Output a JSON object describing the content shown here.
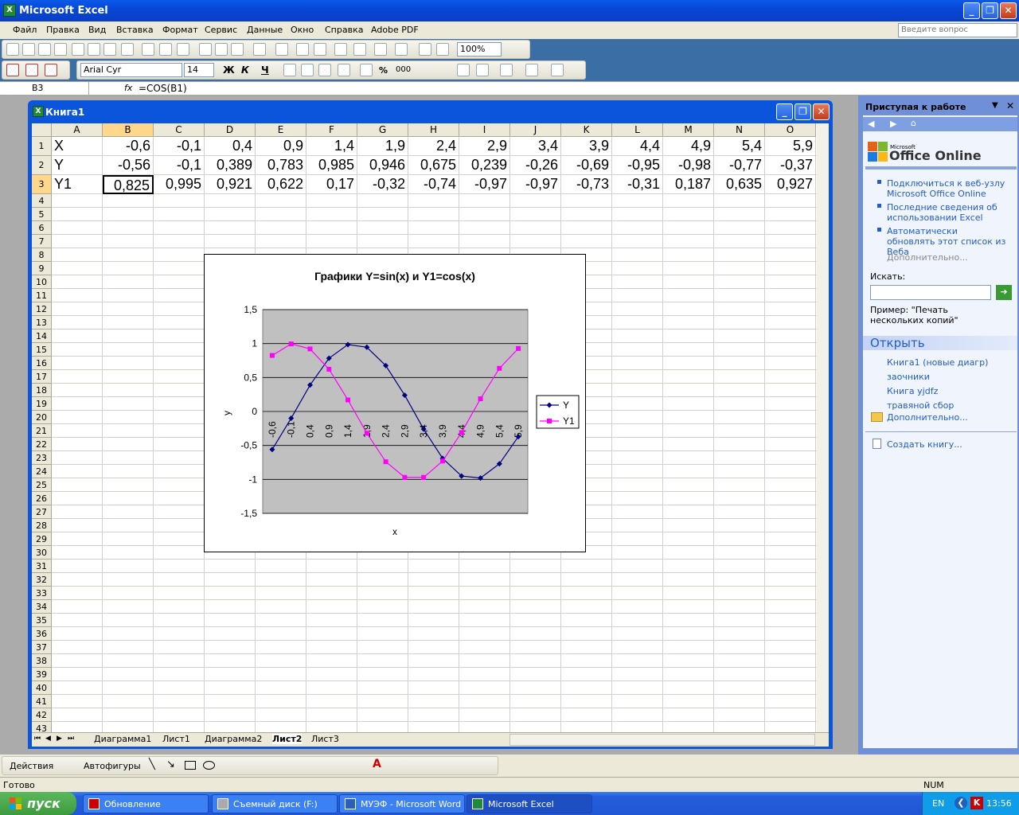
{
  "app": {
    "title": "Microsoft Excel",
    "icon": "excel-icon"
  },
  "menu": [
    "Файл",
    "Правка",
    "Вид",
    "Вставка",
    "Формат",
    "Сервис",
    "Данные",
    "Окно",
    "Справка",
    "Adobe PDF"
  ],
  "help_placeholder": "Введите вопрос",
  "toolbar": {
    "zoom": "100%",
    "font": "Arial Cyr",
    "size": "14",
    "bold": "Ж",
    "italic": "К",
    "underline": "Ч",
    "percent": "%",
    "thousands": "000"
  },
  "formula": {
    "namebox": "B3",
    "fx": "fx",
    "value": "=COS(B1)"
  },
  "workbook": {
    "title": "Книга1"
  },
  "columns": [
    "A",
    "B",
    "C",
    "D",
    "E",
    "F",
    "G",
    "H",
    "I",
    "J",
    "K",
    "L",
    "M",
    "N",
    "O"
  ],
  "rows_count": 43,
  "cells": [
    [
      "X",
      "-0,6",
      "-0,1",
      "0,4",
      "0,9",
      "1,4",
      "1,9",
      "2,4",
      "2,9",
      "3,4",
      "3,9",
      "4,4",
      "4,9",
      "5,4",
      "5,9"
    ],
    [
      "Y",
      "-0,56",
      "-0,1",
      "0,389",
      "0,783",
      "0,985",
      "0,946",
      "0,675",
      "0,239",
      "-0,26",
      "-0,69",
      "-0,95",
      "-0,98",
      "-0,77",
      "-0,37"
    ],
    [
      "Y1",
      "0,825",
      "0,995",
      "0,921",
      "0,622",
      "0,17",
      "-0,32",
      "-0,74",
      "-0,97",
      "-0,97",
      "-0,73",
      "-0,31",
      "0,187",
      "0,635",
      "0,927"
    ]
  ],
  "sheets": [
    "Диаграмма1",
    "Лист1",
    "Диаграмма2",
    "Лист2",
    "Лист3"
  ],
  "active_sheet": "Лист2",
  "chart_data": {
    "type": "line",
    "title": "Графики Y=sin(x) и Y1=cos(x)",
    "xlabel": "x",
    "ylabel": "y",
    "categories": [
      "-0,6",
      "-0,1",
      "0,4",
      "0,9",
      "1,4",
      "1,9",
      "2,4",
      "2,9",
      "3,4",
      "3,9",
      "4,4",
      "4,9",
      "5,4",
      "5,9"
    ],
    "ylim": [
      -1.5,
      1.5
    ],
    "yticks": [
      "1,5",
      "1",
      "0,5",
      "0",
      "-0,5",
      "-1",
      "-1,5"
    ],
    "grid": true,
    "legend": "right",
    "series": [
      {
        "name": "Y",
        "color": "#000080",
        "marker": "diamond",
        "values": [
          -0.56,
          -0.1,
          0.389,
          0.783,
          0.985,
          0.946,
          0.675,
          0.239,
          -0.26,
          -0.69,
          -0.95,
          -0.98,
          -0.77,
          -0.37
        ]
      },
      {
        "name": "Y1",
        "color": "#ff00ff",
        "marker": "square",
        "values": [
          0.825,
          0.995,
          0.921,
          0.622,
          0.17,
          -0.32,
          -0.74,
          -0.97,
          -0.97,
          -0.73,
          -0.31,
          0.187,
          0.635,
          0.927
        ]
      }
    ]
  },
  "taskpane": {
    "title": "Приступая к работе",
    "brand_small": "Microsoft",
    "brand": "Office Online",
    "links": [
      "Подключиться к веб-узлу Microsoft Office Online",
      "Последние сведения об использовании Excel",
      "Автоматически обновлять этот список из Веба"
    ],
    "more": "Дополнительно...",
    "search_label": "Искать:",
    "example": "Пример: \"Печать нескольких копий\"",
    "open_header": "Открыть",
    "files": [
      "Книга1 (новые диагр)",
      "заочники",
      "Книга yjdfz",
      "травяной сбор"
    ],
    "open_more": "Дополнительно...",
    "create": "Создать книгу..."
  },
  "drawbar": {
    "actions": "Действия",
    "autoshapes": "Автофигуры"
  },
  "status": {
    "left": "Готово",
    "num": "NUM"
  },
  "taskbar": {
    "start": "пуск",
    "tasks": [
      "Обновление",
      "Съемный диск (F:)",
      "МУЭФ - Microsoft Word",
      "Microsoft Excel"
    ],
    "lang": "EN",
    "time": "13:56"
  }
}
